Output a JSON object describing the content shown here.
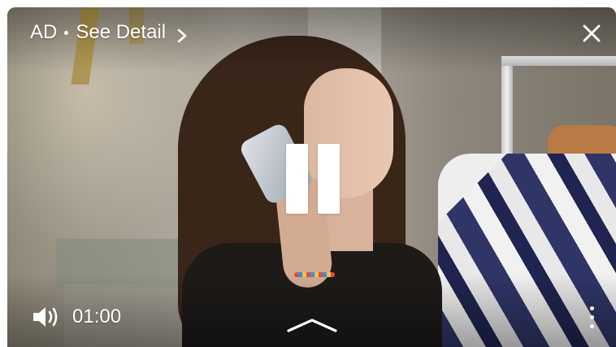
{
  "ad": {
    "tag": "AD",
    "detail_label": "See Detail"
  },
  "playback": {
    "time": "01:00",
    "state": "playing"
  },
  "icons": {
    "detail_chevron": "chevron-right-icon",
    "close": "close-icon",
    "pause": "pause-icon",
    "volume": "volume-icon",
    "expand": "chevron-up-icon",
    "more": "more-vertical-icon"
  },
  "colors": {
    "overlay_text": "#ffffff"
  }
}
